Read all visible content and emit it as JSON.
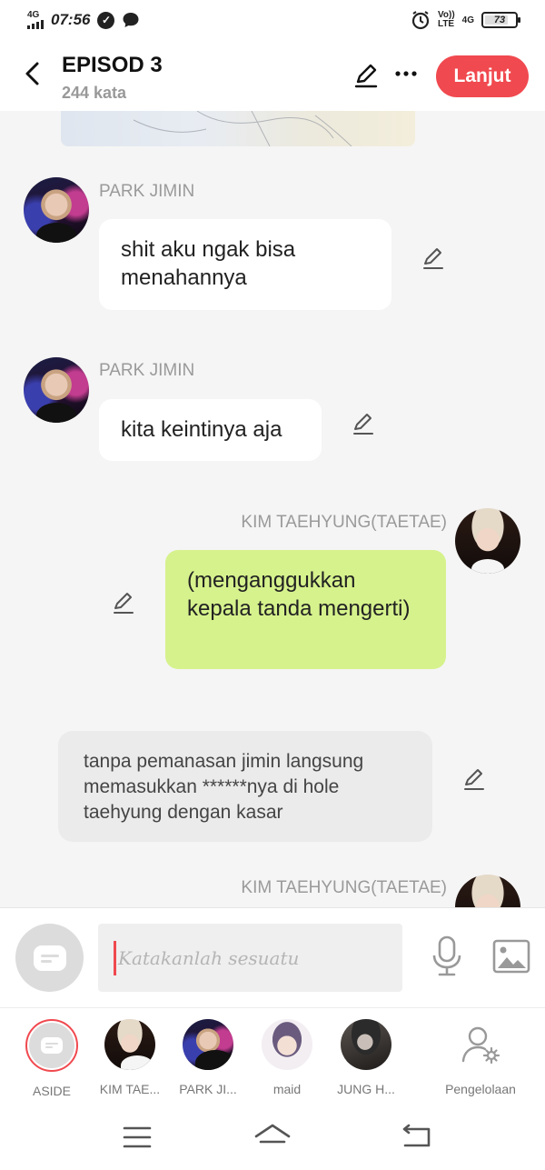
{
  "status_bar": {
    "network": "4G",
    "time": "07:56",
    "volte_top": "Vo))",
    "volte_bottom": "LTE",
    "network_right": "4G",
    "battery": "73"
  },
  "header": {
    "title": "EPISOD 3",
    "subtitle": "244 kata",
    "next_button": "Lanjut"
  },
  "messages": [
    {
      "speaker": "PARK JIMIN",
      "text": "shit aku ngak bisa menahannya",
      "side": "left"
    },
    {
      "speaker": "PARK JIMIN",
      "text": "kita keintinya aja",
      "side": "left"
    },
    {
      "speaker": "KIM TAEHYUNG(TAETAE)",
      "text": "(menganggukkan kepala tanda mengerti)",
      "side": "right"
    },
    {
      "speaker": "",
      "text": "tanpa pemanasan jimin langsung memasukkan ******nya di hole taehyung dengan kasar",
      "side": "narration"
    },
    {
      "speaker": "KIM TAEHYUNG(TAETAE)",
      "text": "",
      "side": "right"
    }
  ],
  "composer": {
    "placeholder": "Katakanlah sesuatu"
  },
  "characters": [
    {
      "label": "ASIDE"
    },
    {
      "label": "KIM TAE..."
    },
    {
      "label": "PARK JI..."
    },
    {
      "label": "maid"
    },
    {
      "label": "JUNG H..."
    },
    {
      "label": "Pengelolaan"
    }
  ],
  "colors": {
    "accent": "#f0494f",
    "green_bubble": "#d6f28d",
    "narration_bubble": "#ebebeb"
  },
  "icons": [
    "back-icon",
    "edit-icon",
    "more-icon",
    "mic-icon",
    "image-icon",
    "manage-icon",
    "menu-icon",
    "home-icon",
    "back-nav-icon"
  ]
}
